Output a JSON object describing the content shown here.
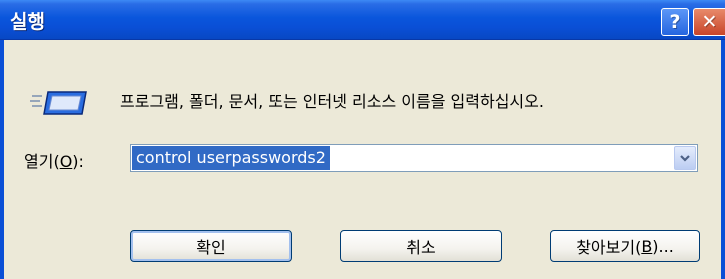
{
  "window": {
    "title": "실행",
    "help_glyph": "?",
    "close_glyph": "✕"
  },
  "message": "프로그램, 폴더, 문서, 또는 인터넷 리소스 이름을 입력하십시오.",
  "open_field": {
    "label_prefix": "열기(",
    "label_mnemonic": "O",
    "label_suffix": "):",
    "value": "control userpasswords2"
  },
  "buttons": {
    "ok": "확인",
    "cancel": "취소",
    "browse_prefix": "찾아보기(",
    "browse_mnemonic": "B",
    "browse_suffix": ")..."
  },
  "icons": {
    "run": "run-program-icon",
    "dropdown": "chevron-down-icon"
  },
  "colors": {
    "titlebar": "#0a4fd6",
    "selection": "#316ac5",
    "dialog_bg": "#ece9d8",
    "close_button": "#c8452a"
  }
}
